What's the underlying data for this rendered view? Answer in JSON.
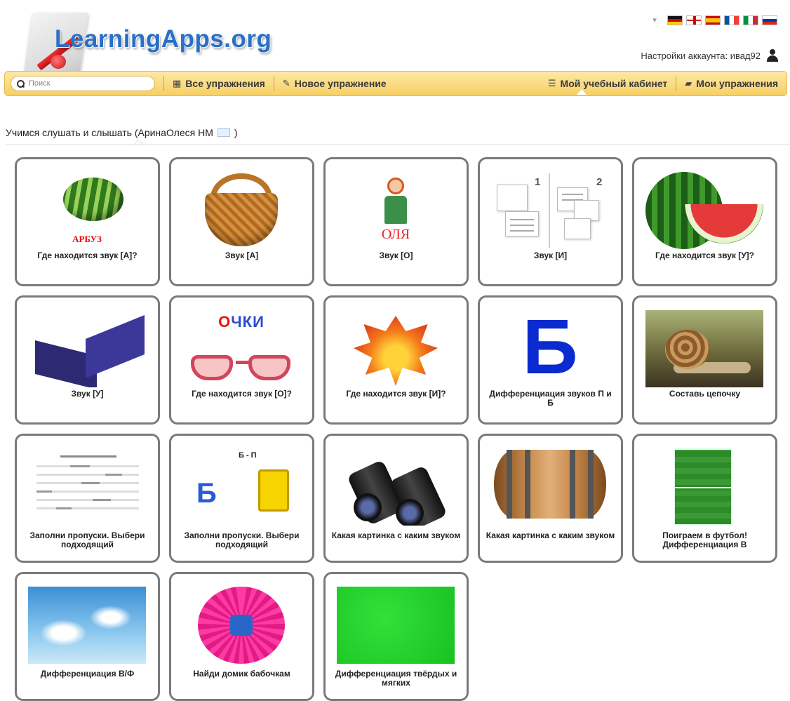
{
  "header": {
    "logo_text": "LearningApps.org",
    "account_label": "Настройки аккаунта: ивад92"
  },
  "languages": [
    "Deutsch",
    "English",
    "Español",
    "Français",
    "Italiano",
    "Русский"
  ],
  "nav": {
    "search_placeholder": "Поиск",
    "all_exercises": "Все упражнения",
    "new_exercise": "Новое упражнение",
    "my_cabinet": "Мой учебный кабинет",
    "my_exercises": "Мои упражнения"
  },
  "page": {
    "title_prefix": "Учимся слушать и слышать (АринаОлеся НМ",
    "title_suffix": ")"
  },
  "tiles": [
    {
      "caption": "Где находится звук [А]?",
      "image_label": "АРБУЗ",
      "icon": "watermelon"
    },
    {
      "caption": "Звук [А]",
      "icon": "basket"
    },
    {
      "caption": "Звук [О]",
      "image_label": "ОЛЯ",
      "icon": "doll"
    },
    {
      "caption": "Звук [И]",
      "icon": "placeholder-docs"
    },
    {
      "caption": "Где находится звук [У]?",
      "icon": "watermelon-slice"
    },
    {
      "caption": "Звук [У]",
      "icon": "box"
    },
    {
      "caption": "Где находится звук [О]?",
      "image_label": "ОЧКИ",
      "icon": "glasses"
    },
    {
      "caption": "Где находится звук [И]?",
      "icon": "maple-leaf"
    },
    {
      "caption": "Дифференциация звуков П и Б",
      "image_label": "Б",
      "icon": "letter-b"
    },
    {
      "caption": "Составь цепочку",
      "icon": "snail"
    },
    {
      "caption": "Заполни пропуски. Выбери подходящий",
      "icon": "fill-gaps"
    },
    {
      "caption": "Заполни пропуски. Выбери подходящий",
      "image_label": "Б - П",
      "icon": "letters-b-p"
    },
    {
      "caption": "Какая картинка с каким звуком",
      "icon": "binoculars"
    },
    {
      "caption": "Какая картинка с каким звуком",
      "icon": "barrel"
    },
    {
      "caption": "Поиграем в футбол! Дифференциация В",
      "icon": "football-field"
    },
    {
      "caption": "Дифференциация В/Ф",
      "icon": "sky"
    },
    {
      "caption": "Найди домик бабочкам",
      "icon": "flower"
    },
    {
      "caption": "Дифференциация твёрдых и мягких",
      "icon": "green-square"
    }
  ]
}
